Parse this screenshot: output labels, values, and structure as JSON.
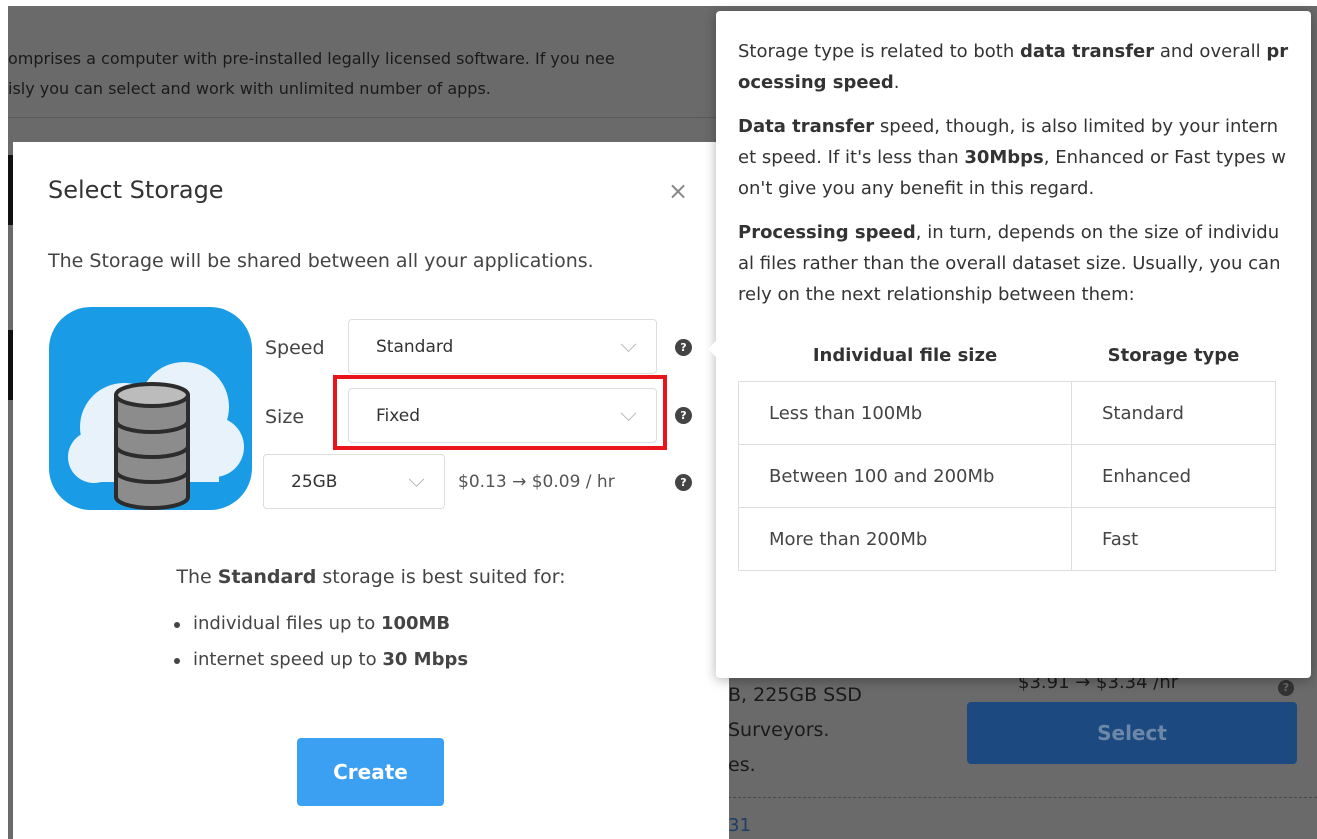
{
  "background": {
    "intro_line1": "omprises a computer with pre-installed legally licensed software. If you nee",
    "intro_line2": "isly you can select and work with unlimited number of apps.",
    "card_line1": "B, 225GB SSD",
    "card_line2": "Surveyors.",
    "card_line3": "es.",
    "card_price": "$3.91 → $3.34 /hr",
    "select_label": "Select",
    "link_text": "31"
  },
  "modal": {
    "title": "Select Storage",
    "close_symbol": "×",
    "subtitle": "The Storage will be shared between all your applications.",
    "speed_label": "Speed",
    "speed_value": "Standard",
    "size_label": "Size",
    "size_value": "Fixed",
    "capacity_value": "25GB",
    "price": "$0.13 → $0.09 / hr",
    "help_symbol": "?",
    "info_prefix": "The ",
    "info_bold": "Standard",
    "info_suffix": " storage is best suited for:",
    "bullets": [
      {
        "prefix": "individual files up to ",
        "bold": "100MB"
      },
      {
        "prefix": "internet speed up to ",
        "bold": "30 Mbps"
      }
    ],
    "create_label": "Create"
  },
  "tooltip": {
    "p1_a": "Storage type is related to both ",
    "p1_b": "data transfer",
    "p1_c": " and overall ",
    "p1_d": "processing speed",
    "p1_e": ".",
    "p2_a": "Data transfer",
    "p2_b": " speed, though, is also limited by your internet speed. If it's less than ",
    "p2_c": "30Mbps",
    "p2_d": ", Enhanced or Fast types won't give you any benefit in this regard.",
    "p3_a": "Processing speed",
    "p3_b": ", in turn, depends on the size of individual files rather than the overall dataset size. Usually, you can rely on the next relationship between them:",
    "table": {
      "headers": [
        "Individual file size",
        "Storage type"
      ],
      "rows": [
        [
          "Less than 100Mb",
          "Standard"
        ],
        [
          "Between 100 and 200Mb",
          "Enhanced"
        ],
        [
          "More than 200Mb",
          "Fast"
        ]
      ]
    }
  },
  "colors": {
    "overlay_gray": "#6a6a6a",
    "create_button": "#3b9ff2",
    "highlight_red": "#e8161b",
    "icon_blue": "#1a9be6"
  }
}
